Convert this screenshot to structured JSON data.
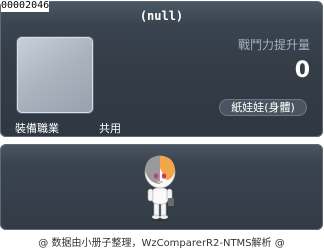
{
  "item": {
    "id": "00002046",
    "title": "(null)",
    "equip_label": "裝備職業",
    "job": "共用",
    "boost_label": "戰鬥力提升量",
    "boost_value": "0",
    "type": "紙娃娃(身體)"
  },
  "footer": {
    "text": "@ 数据由小册子整理，WzComparerR2-NTMS解析 @"
  },
  "colors": {
    "panel": "#343d48",
    "icon_frame": "#aab3be",
    "secondary_text": "#a6b0bc"
  },
  "icons": {
    "preview": "character-sprite"
  }
}
